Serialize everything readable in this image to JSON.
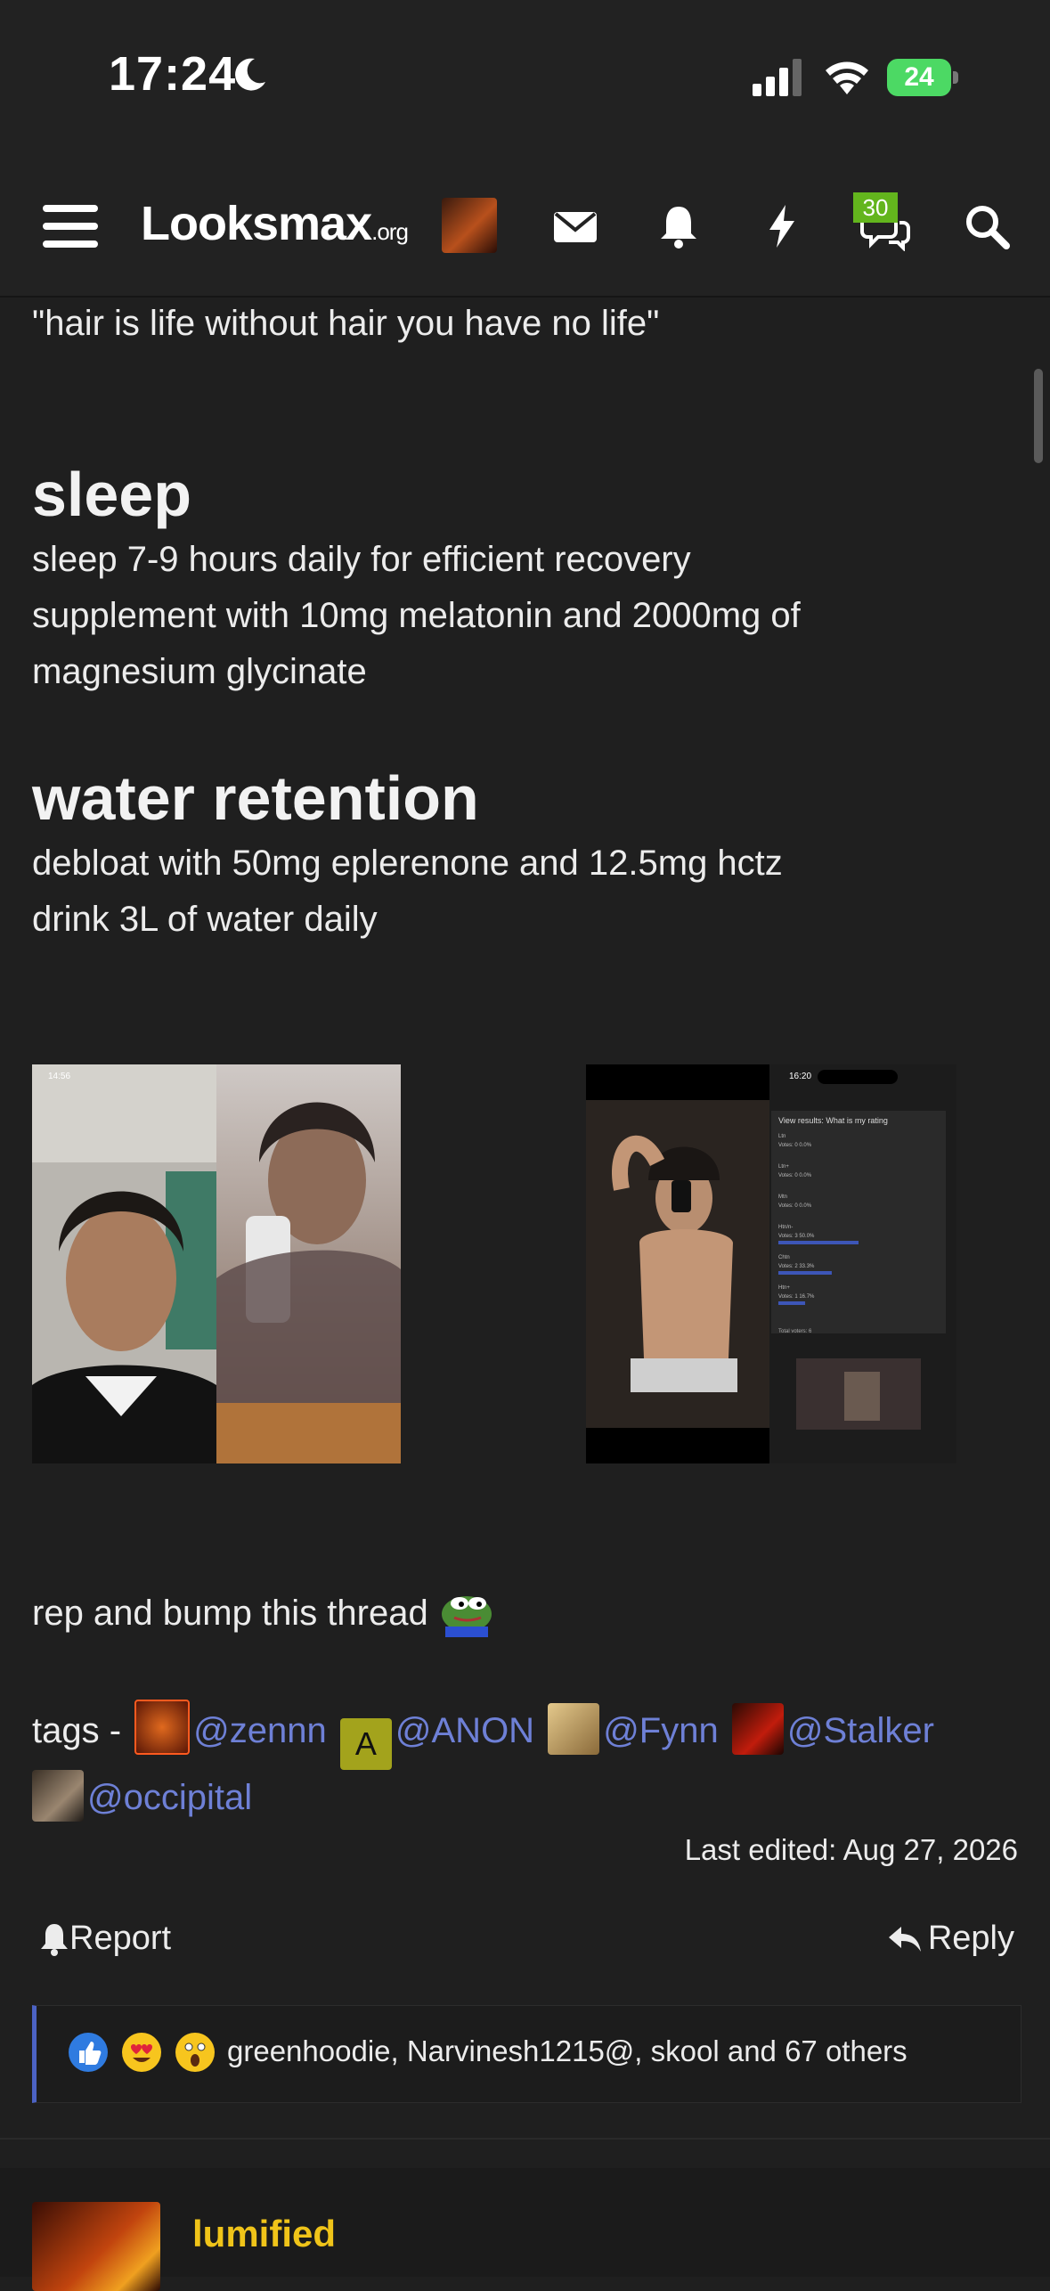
{
  "status_bar": {
    "time": "17:24",
    "battery": "24"
  },
  "header": {
    "logo_main": "Looksmax",
    "logo_domain": ".org",
    "badge_count": "30",
    "icons": [
      "menu-icon",
      "envelope-icon",
      "bell-icon",
      "bolt-icon",
      "chat-icon",
      "search-icon"
    ]
  },
  "post": {
    "quote_line": "\"hair is life without hair you have no life\"",
    "sections": [
      {
        "heading": "sleep",
        "lines": [
          "sleep 7-9 hours daily for efficient recovery",
          "supplement with 10mg melatonin and 2000mg of",
          "magnesium glycinate"
        ]
      },
      {
        "heading": "water retention",
        "lines": [
          "debloat with 50mg eplerenone and 12.5mg hctz",
          "drink 3L of water daily"
        ]
      }
    ],
    "screenshot_mock": {
      "time1": "14:56",
      "time2": "16:20",
      "poll_title": "View results: What is my rating",
      "poll_rows": [
        {
          "label": "Ltn",
          "votes": "Votes: 0",
          "pct": "0.0%",
          "fraction": 0.0
        },
        {
          "label": "Ltn+",
          "votes": "Votes: 0",
          "pct": "0.0%",
          "fraction": 0.0
        },
        {
          "label": "Mtn",
          "votes": "Votes: 0",
          "pct": "0.0%",
          "fraction": 0.0
        },
        {
          "label": "Htn/n-",
          "votes": "Votes: 3",
          "pct": "50.0%",
          "fraction": 0.5
        },
        {
          "label": "Chtn",
          "votes": "Votes: 2",
          "pct": "33.3%",
          "fraction": 0.333
        },
        {
          "label": "Htn+",
          "votes": "Votes: 1",
          "pct": "16.7%",
          "fraction": 0.167
        }
      ],
      "poll_total": "Total voters: 6"
    },
    "bump_text": "rep and bump this thread",
    "tags_label": "tags -",
    "tags": [
      {
        "name": "@zennn"
      },
      {
        "name": "@ANON",
        "avatar_letter": "A"
      },
      {
        "name": "@Fynn"
      },
      {
        "name": "@Stalker"
      },
      {
        "name": "@occipital"
      }
    ],
    "last_edited": "Last edited: Aug 27, 2026",
    "report_label": "Report",
    "reply_label": "Reply",
    "reactions_text": "greenhoodie, Narvinesh1215@, skool and 67 others"
  },
  "next_post": {
    "username": "lumified"
  },
  "colors": {
    "accent": "#6e80d6",
    "username": "#f0c419",
    "badge": "#63b51d"
  }
}
